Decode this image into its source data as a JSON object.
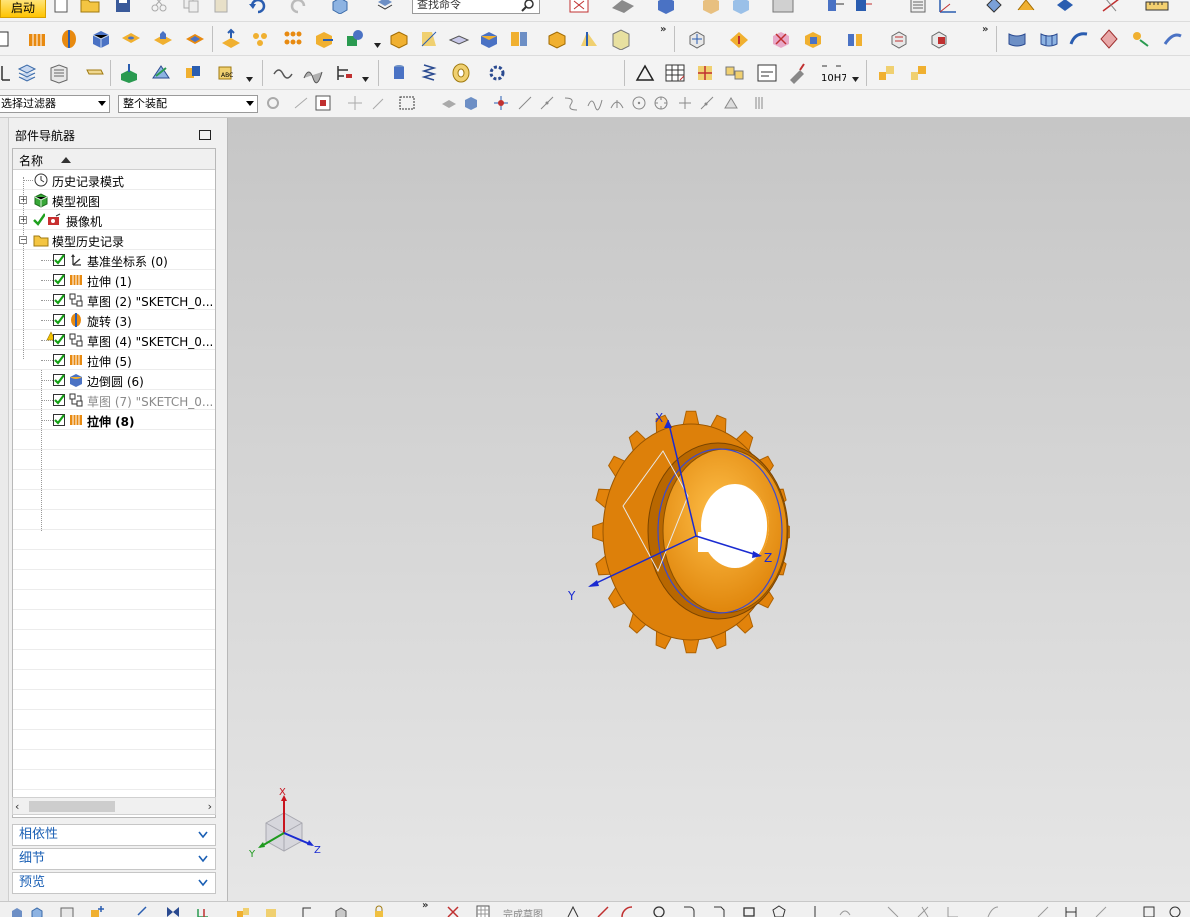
{
  "toolbar": {
    "start_label": "启动",
    "find_command_placeholder": "查找命令",
    "more_glyph": "»"
  },
  "selection_bar": {
    "filter_value": "选择过滤器",
    "scope_value": "整个装配"
  },
  "navigator": {
    "title": "部件导航器",
    "column_name": "名称",
    "nodes": [
      {
        "label": "历史记录模式"
      },
      {
        "label": "模型视图"
      },
      {
        "label": "摄像机"
      },
      {
        "label": "模型历史记录"
      }
    ],
    "features": [
      {
        "label": "基准坐标系 (0)"
      },
      {
        "label": "拉伸 (1)"
      },
      {
        "label": "草图 (2) \"SKETCH_0..."
      },
      {
        "label": "旋转 (3)"
      },
      {
        "label": "草图 (4) \"SKETCH_0..."
      },
      {
        "label": "拉伸 (5)"
      },
      {
        "label": "边倒圆 (6)"
      },
      {
        "label": "草图 (7) \"SKETCH_0..."
      },
      {
        "label": "拉伸 (8)"
      }
    ],
    "panels": [
      {
        "label": "相依性"
      },
      {
        "label": "细节"
      },
      {
        "label": "预览"
      }
    ]
  },
  "viewport": {
    "axes": {
      "x": "X",
      "y": "Y",
      "z": "Z"
    }
  },
  "status_bar": {
    "text": "完成草图"
  },
  "colors": {
    "gear": "#e2830b",
    "gear_dark": "#b06200",
    "hub": "#f3a028",
    "axis_blue": "#1a2bd1",
    "axis_red": "#c8141e",
    "axis_green": "#1e9a1e",
    "panel_text": "#1a5fb4"
  }
}
